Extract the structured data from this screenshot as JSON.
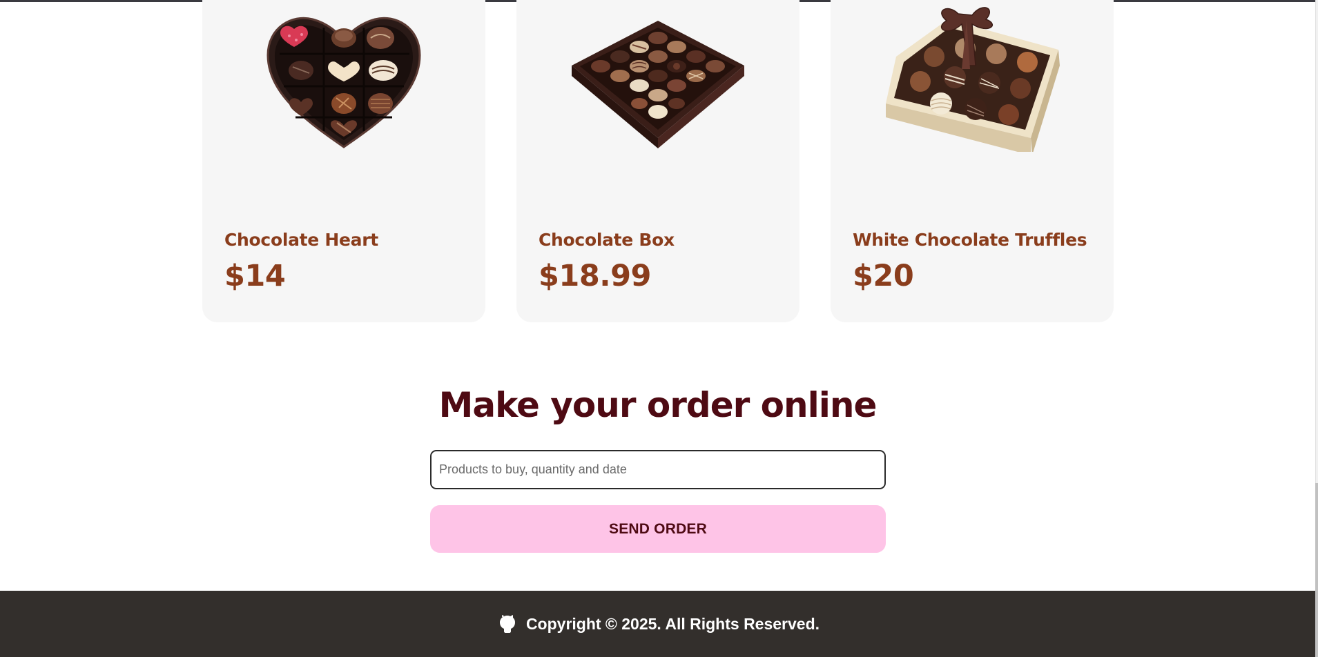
{
  "products": [
    {
      "title": "Chocolate Heart",
      "price": "$14",
      "image_icon": "heart-chocolate-box-image"
    },
    {
      "title": "Chocolate Box",
      "price": "$18.99",
      "image_icon": "square-chocolate-box-image"
    },
    {
      "title": "White Chocolate Truffles",
      "price": "$20",
      "image_icon": "white-truffle-box-image"
    }
  ],
  "order": {
    "title": "Make your order online",
    "input_placeholder": "Products to buy, quantity and date",
    "input_value": "",
    "button_label": "SEND ORDER"
  },
  "footer": {
    "icon": "github-icon",
    "copyright": "Copyright © 2025. All Rights Reserved."
  },
  "colors": {
    "product_text": "#8a3d1c",
    "heading": "#4e0a13",
    "button_bg": "#fec4e7",
    "card_bg": "#f6f6f6",
    "footer_bg": "#332f2c"
  }
}
